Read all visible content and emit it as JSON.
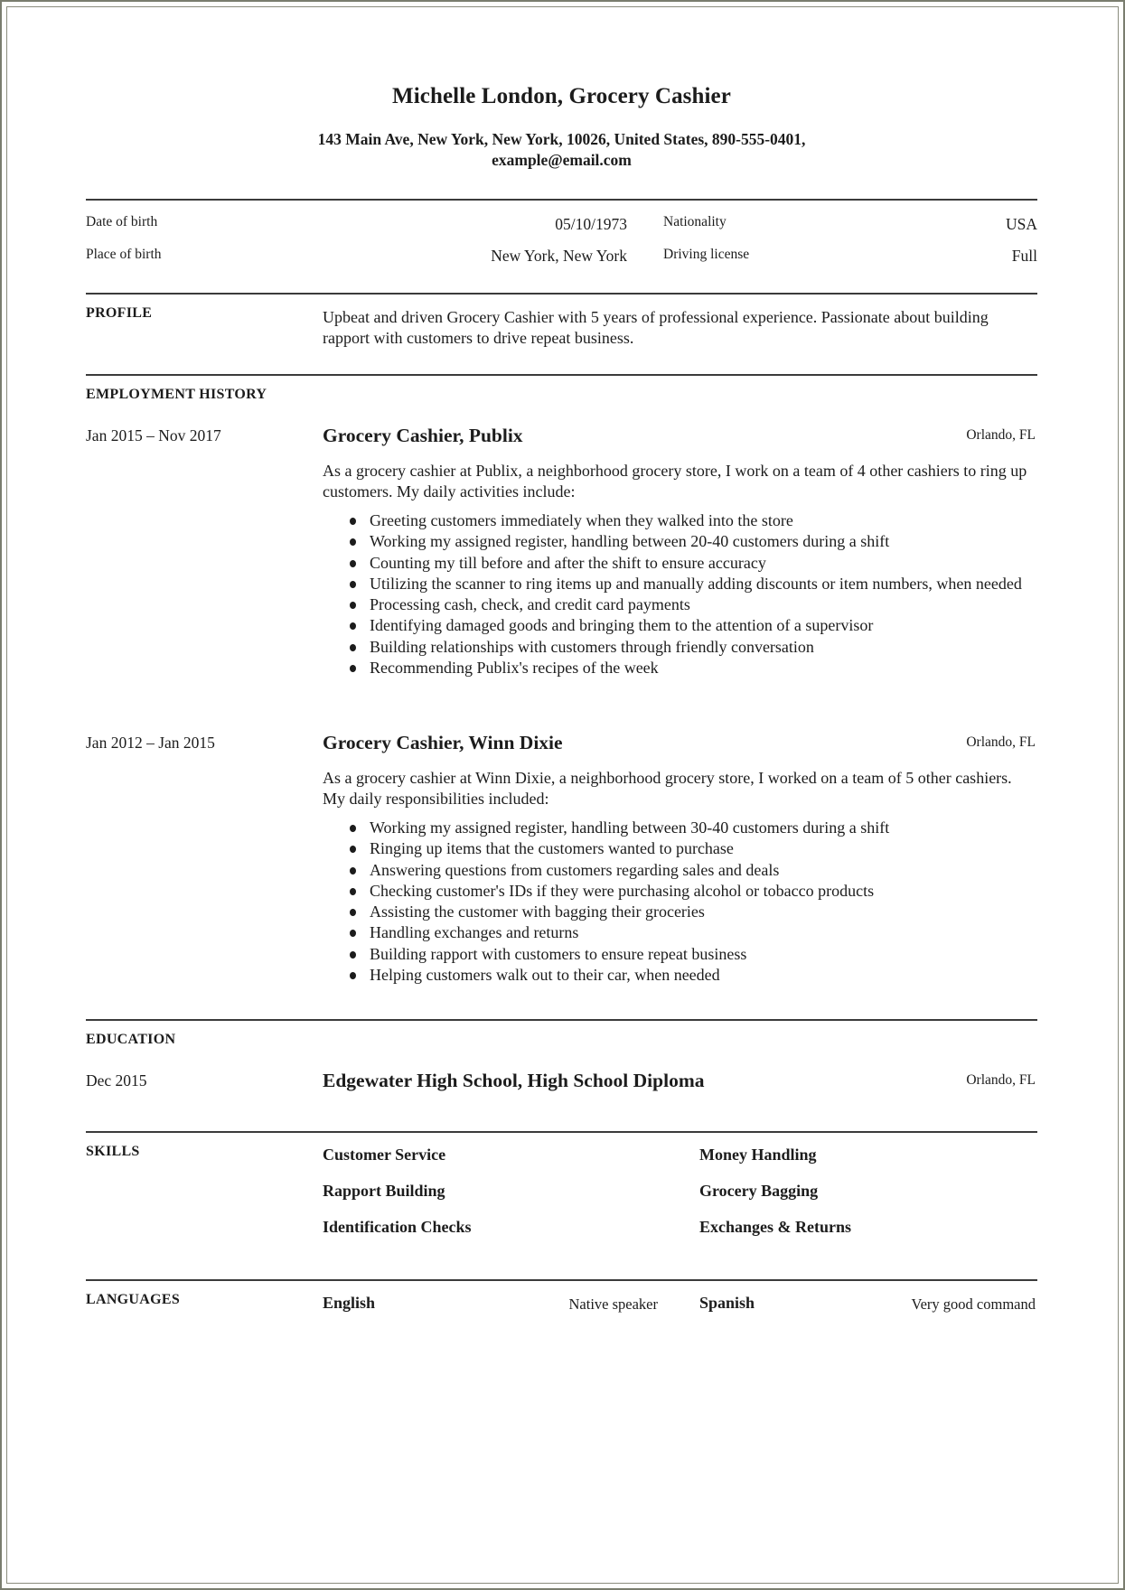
{
  "header": {
    "name_title": "Michelle London, Grocery Cashier",
    "contact_line1": "143 Main Ave, New York, New York, 10026, United States, 890-555-0401,",
    "contact_line2": "example@email.com"
  },
  "details": {
    "date_of_birth_label": "Date of birth",
    "date_of_birth": "05/10/1973",
    "place_of_birth_label": "Place of birth",
    "place_of_birth": "New York, New York",
    "nationality_label": "Nationality",
    "nationality": "USA",
    "driving_license_label": "Driving license",
    "driving_license": "Full"
  },
  "profile": {
    "heading": "PROFILE",
    "text": "Upbeat and driven Grocery Cashier with 5 years of professional experience. Passionate about building rapport with customers to drive repeat business."
  },
  "employment": {
    "heading": "EMPLOYMENT HISTORY",
    "jobs": [
      {
        "dates": "Jan 2015 – Nov 2017",
        "title": "Grocery Cashier, Publix",
        "location": "Orlando, FL",
        "summary": "As a grocery cashier at Publix, a neighborhood grocery store, I work on a team of 4 other cashiers to ring up customers. My daily activities include:",
        "bullets": [
          "Greeting customers immediately when they walked into the store",
          "Working my assigned register, handling between 20-40 customers during a shift",
          "Counting my till before and after the shift to ensure accuracy",
          "Utilizing the scanner to ring items up and manually adding discounts or item numbers, when needed",
          "Processing cash, check, and credit card payments",
          "Identifying damaged goods and bringing them to the attention of a supervisor",
          "Building relationships with customers through friendly conversation",
          "Recommending Publix's recipes of the week"
        ]
      },
      {
        "dates": "Jan 2012 – Jan 2015",
        "title": "Grocery Cashier, Winn Dixie",
        "location": "Orlando, FL",
        "summary": "As a grocery cashier at Winn Dixie, a neighborhood grocery store, I worked on a team of 5 other cashiers. My daily responsibilities included:",
        "bullets": [
          "Working my assigned register, handling between 30-40 customers during a shift",
          "Ringing up items that the customers wanted to purchase",
          "Answering questions from customers regarding sales and deals",
          "Checking customer's IDs if they were purchasing alcohol or tobacco products",
          "Assisting the customer with bagging their groceries",
          "Handling exchanges and returns",
          "Building rapport with customers to ensure repeat business",
          "Helping customers walk out to their car, when needed"
        ]
      }
    ]
  },
  "education": {
    "heading": "EDUCATION",
    "entries": [
      {
        "dates": "Dec 2015",
        "title": "Edgewater High School, High School Diploma",
        "location": "Orlando, FL"
      }
    ]
  },
  "skills": {
    "heading": "SKILLS",
    "items": [
      "Customer Service",
      "Money Handling",
      "Rapport Building",
      "Grocery Bagging",
      "Identification Checks",
      "Exchanges & Returns"
    ]
  },
  "languages": {
    "heading": "LANGUAGES",
    "items": [
      {
        "name": "English",
        "level": "Native speaker"
      },
      {
        "name": "Spanish",
        "level": "Very good command"
      }
    ]
  }
}
